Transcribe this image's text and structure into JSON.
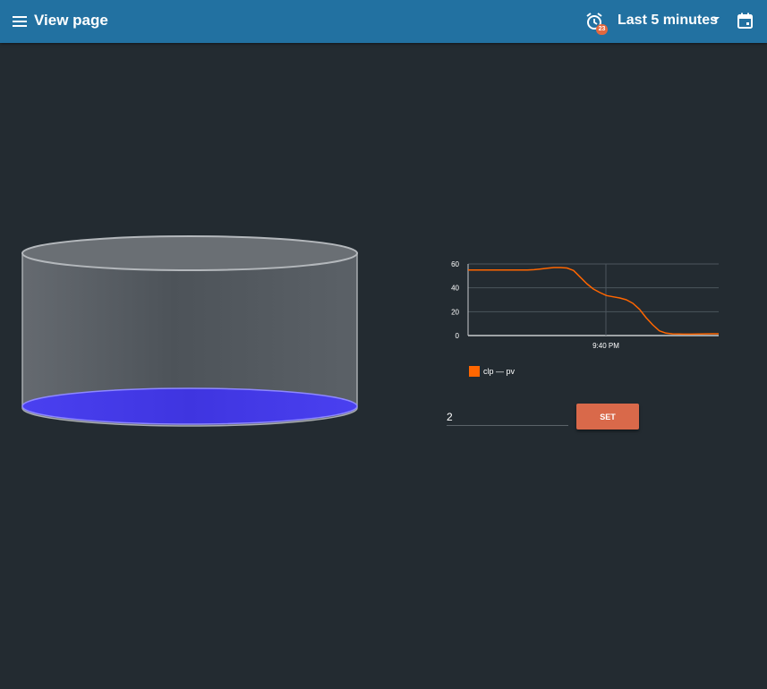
{
  "header": {
    "title": "View page",
    "alarm_count": "23",
    "time_range": "Last 5 minutes",
    "icons": {
      "menu": "menu-icon",
      "alarm": "alarm-clock-icon",
      "dropdown": "caret-down-icon",
      "calendar": "calendar-icon"
    }
  },
  "tank": {
    "fill_level": 0.02,
    "liquid_color": "#3f35e0",
    "shell_color": "#6b7177"
  },
  "colors": {
    "header": "#2271a1",
    "background": "#232b31",
    "set_button": "#d9694a",
    "series": "#ff6600"
  },
  "chart_data": {
    "type": "line",
    "x_ticks": [
      "9:40 PM"
    ],
    "y_ticks": [
      0,
      20,
      40,
      60
    ],
    "ylim": [
      0,
      60
    ],
    "grid": true,
    "legend_placement": "bottom-left",
    "series": [
      {
        "name": "clp — pv",
        "color": "#ff6600",
        "values": [
          55,
          55,
          55,
          55,
          55,
          55,
          55,
          55,
          55,
          55,
          55.2,
          55.8,
          56.5,
          57,
          57,
          56.6,
          54.5,
          49,
          43.5,
          39,
          36,
          33.5,
          32.5,
          31.5,
          30,
          27,
          22,
          15,
          9,
          4,
          2,
          1.4,
          1.3,
          1.2,
          1.2,
          1.3,
          1.4,
          1.5,
          1.5
        ]
      }
    ]
  },
  "control": {
    "value": "2",
    "set_label": "SET"
  }
}
